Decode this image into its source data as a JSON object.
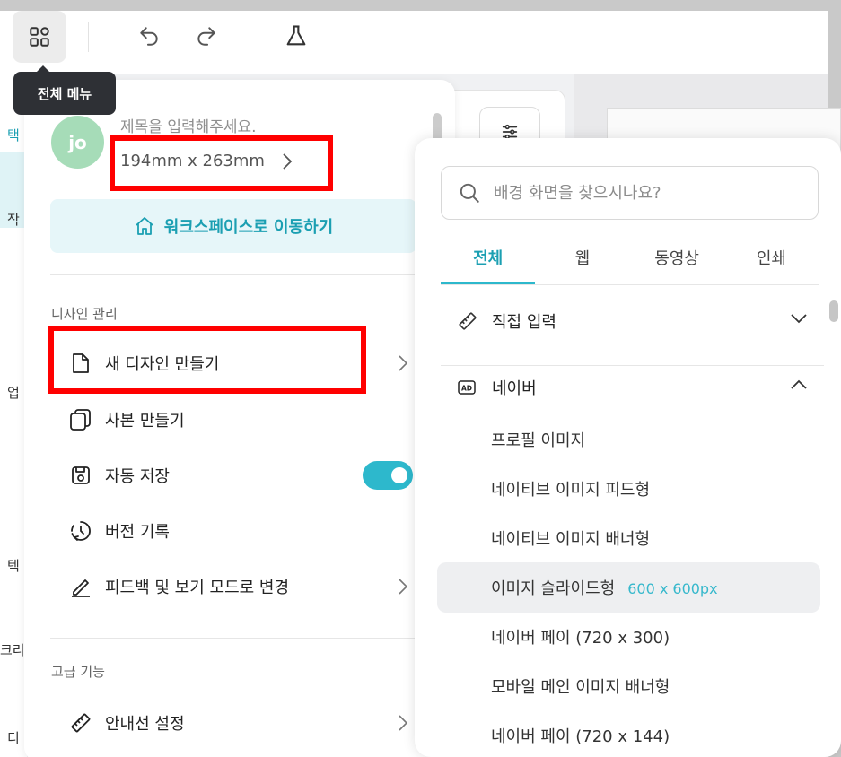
{
  "toolbar": {
    "menu_icon": "grid-apps-icon",
    "undo_icon": "undo-icon",
    "redo_icon": "redo-icon",
    "lab_icon": "flask-icon",
    "tooltip": "전체 메뉴"
  },
  "left_rail": {
    "letters": [
      "택",
      "작",
      "업",
      "텍",
      "크리",
      "디"
    ]
  },
  "menu": {
    "avatar_initials": "jo",
    "doc_title_placeholder": "제목을 입력해주세요.",
    "doc_size": "194mm x 263mm",
    "workspace_button": "워크스페이스로 이동하기",
    "design_section_label": "디자인 관리",
    "items": [
      {
        "label": "새 디자인 만들기",
        "icon": "file-icon"
      },
      {
        "label": "사본 만들기",
        "icon": "copy-icon"
      },
      {
        "label": "자동 저장",
        "icon": "save-icon"
      },
      {
        "label": "버전 기록",
        "icon": "history-icon"
      },
      {
        "label": "피드백 및 보기 모드로 변경",
        "icon": "pencil-icon"
      }
    ],
    "autosave_on": true,
    "advanced_section_label": "고급 기능",
    "advanced_items": [
      {
        "label": "안내선 설정",
        "icon": "ruler-icon"
      }
    ]
  },
  "submenu": {
    "search_placeholder": "배경 화면을 찾으시나요?",
    "tabs": [
      "전체",
      "웹",
      "동영상",
      "인쇄"
    ],
    "active_tab": "전체",
    "direct_input_label": "직접 입력",
    "naver_label": "네이버",
    "naver_badge": "AD",
    "naver_items": [
      {
        "label": "프로필 이미지",
        "size": ""
      },
      {
        "label": "네이티브 이미지 피드형",
        "size": ""
      },
      {
        "label": "네이티브 이미지 배너형",
        "size": ""
      },
      {
        "label": "이미지 슬라이드형",
        "size": "600 x 600px"
      },
      {
        "label": "네이버 페이 (720 x 300)",
        "size": ""
      },
      {
        "label": "모바일 메인 이미지 배너형",
        "size": ""
      },
      {
        "label": "네이버 페이 (720 x 144)",
        "size": ""
      }
    ]
  },
  "colors": {
    "accent": "#2db8cc",
    "highlight_box": "#ff0000"
  }
}
